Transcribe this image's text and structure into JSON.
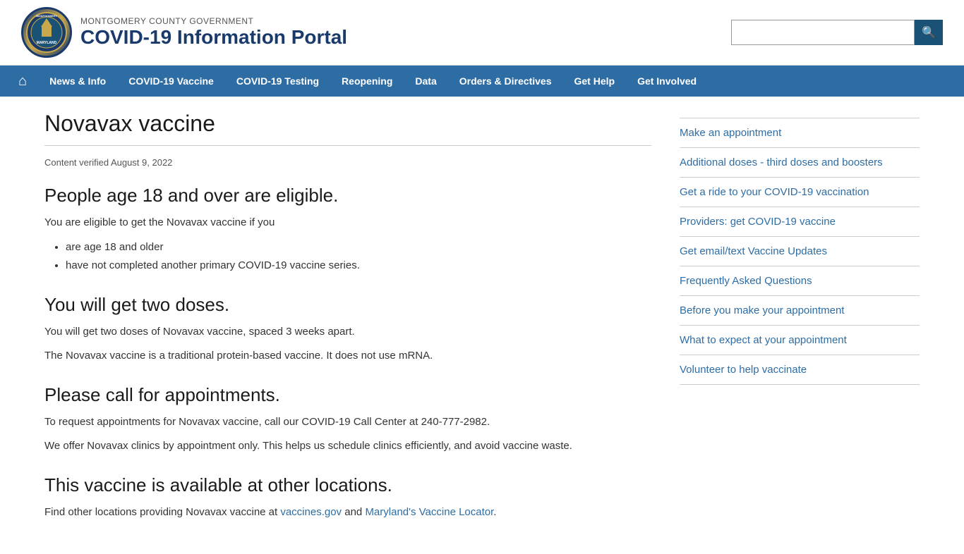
{
  "header": {
    "gov_label": "MONTGOMERY COUNTY GOVERNMENT",
    "site_title": "COVID-19 Information Portal",
    "logo_text": "MONTGOMERY\nCOUNTY\nMARYLAND",
    "search_placeholder": ""
  },
  "nav": {
    "home_icon": "⌂",
    "items": [
      {
        "label": "News & Info",
        "id": "news-info"
      },
      {
        "label": "COVID-19 Vaccine",
        "id": "covid-vaccine"
      },
      {
        "label": "COVID-19 Testing",
        "id": "covid-testing"
      },
      {
        "label": "Reopening",
        "id": "reopening"
      },
      {
        "label": "Data",
        "id": "data"
      },
      {
        "label": "Orders & Directives",
        "id": "orders-directives"
      },
      {
        "label": "Get Help",
        "id": "get-help"
      },
      {
        "label": "Get Involved",
        "id": "get-involved"
      }
    ]
  },
  "page": {
    "title": "Novavax vaccine",
    "verified": "Content verified August 9, 2022",
    "sections": [
      {
        "id": "eligibility",
        "heading": "People age 18 and over are eligible.",
        "paragraphs": [
          "You are eligible to get the Novavax vaccine if you"
        ],
        "list": [
          "are age 18 and older",
          "have not completed another primary COVID-19 vaccine series."
        ]
      },
      {
        "id": "two-doses",
        "heading": "You will get two doses.",
        "paragraphs": [
          "You will get two doses of Novavax vaccine, spaced 3 weeks apart.",
          "The Novavax vaccine is a traditional protein-based vaccine. It does not use mRNA."
        ],
        "list": []
      },
      {
        "id": "appointments",
        "heading": "Please call for appointments.",
        "paragraphs": [
          "To request appointments for Novavax vaccine, call our COVID-19 Call Center at 240-777-2982.",
          "We offer Novavax clinics by appointment only. This helps us schedule clinics efficiently, and avoid vaccine waste."
        ],
        "list": []
      },
      {
        "id": "locations",
        "heading": "This vaccine is available at other locations.",
        "paragraphs": [
          "Find other locations providing Novavax vaccine at vaccines.gov and Maryland's Vaccine Locator."
        ],
        "list": []
      }
    ]
  },
  "sidebar": {
    "links": [
      {
        "label": "Make an appointment",
        "id": "make-appointment"
      },
      {
        "label": "Additional doses - third doses and boosters",
        "id": "additional-doses"
      },
      {
        "label": "Get a ride to your COVID-19 vaccination",
        "id": "get-ride"
      },
      {
        "label": "Providers: get COVID-19 vaccine",
        "id": "providers"
      },
      {
        "label": "Get email/text Vaccine Updates",
        "id": "email-updates"
      },
      {
        "label": "Frequently Asked Questions",
        "id": "faq"
      },
      {
        "label": "Before you make your appointment",
        "id": "before-appointment"
      },
      {
        "label": "What to expect at your appointment",
        "id": "what-to-expect"
      },
      {
        "label": "Volunteer to help vaccinate",
        "id": "volunteer"
      }
    ]
  },
  "search_icon": "🔍"
}
